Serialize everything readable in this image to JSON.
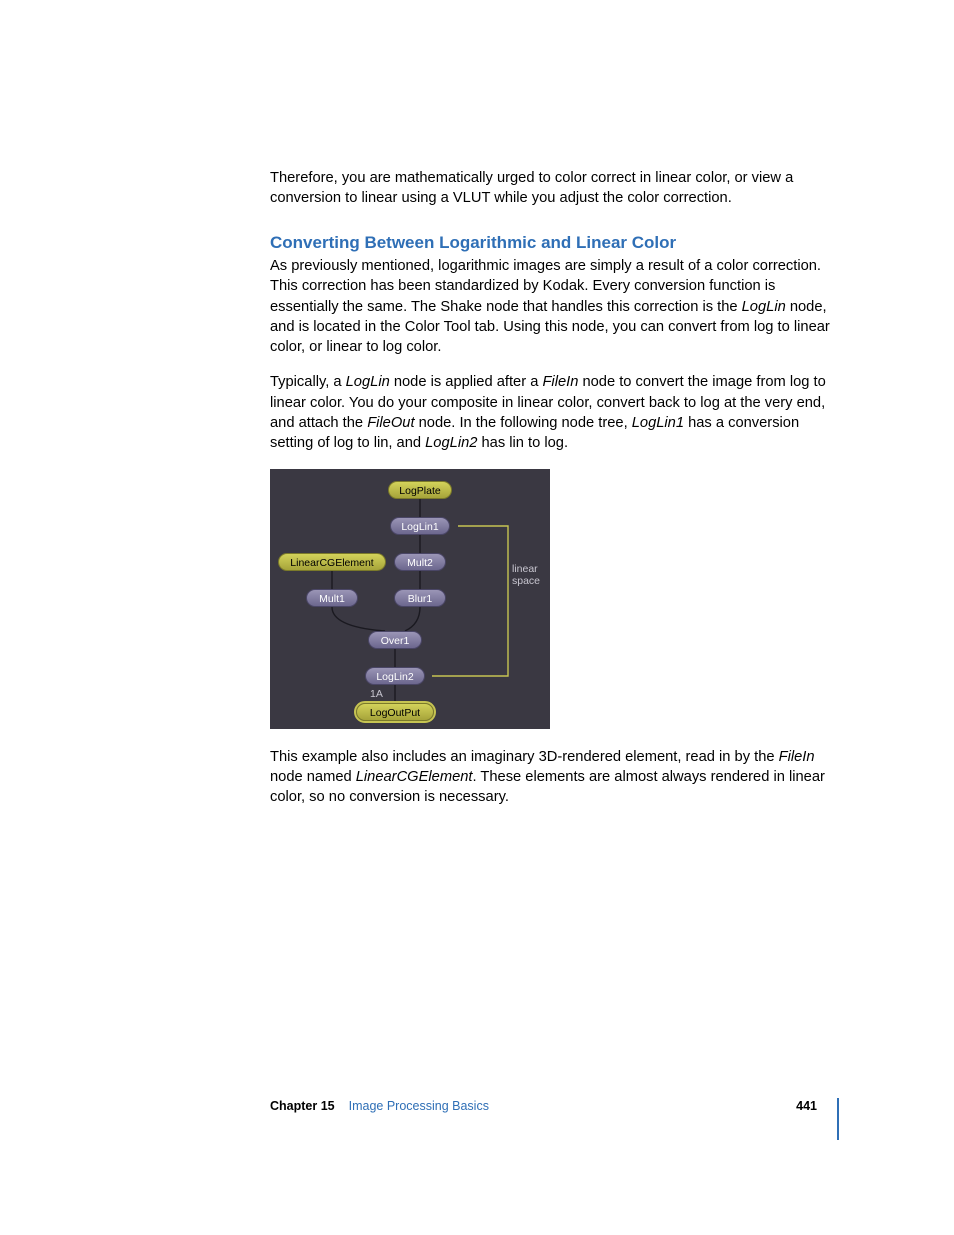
{
  "para1_a": "Therefore, you are mathematically urged to color correct in linear color, or view a conversion to linear using a VLUT while you adjust the color correction.",
  "heading": "Converting Between Logarithmic and Linear Color",
  "para2_a": "As previously mentioned, logarithmic images are simply a result of a color correction. This correction has been standardized by Kodak. Every conversion function is essentially the same. The Shake node that handles this correction is the ",
  "para2_i1": "LogLin",
  "para2_b": " node, and is located in the Color Tool tab. Using this node, you can convert from log to linear color, or linear to log color.",
  "para3_a": "Typically, a ",
  "para3_i1": "LogLin",
  "para3_b": " node is applied after a ",
  "para3_i2": "FileIn",
  "para3_c": " node to convert the image from log to linear color. You do your composite in linear color, convert back to log at the very end, and attach the ",
  "para3_i3": "FileOut",
  "para3_d": " node. In the following node tree, ",
  "para3_i4": "LogLin1",
  "para3_e": " has a conversion setting of log to lin, and ",
  "para3_i5": "LogLin2",
  "para3_f": " has lin to log.",
  "para4_a": "This example also includes an imaginary 3D-rendered element, read in by the ",
  "para4_i1": "FileIn",
  "para4_b": " node named ",
  "para4_i2": "LinearCGElement",
  "para4_c": ". These elements are almost always rendered in linear color, so no conversion is necessary.",
  "nodes": {
    "logplate": "LogPlate",
    "loglin1": "LogLin1",
    "lincg": "LinearCGElement",
    "mult2": "Mult2",
    "mult1": "Mult1",
    "blur1": "Blur1",
    "over1": "Over1",
    "loglin2": "LogLin2",
    "port": "1A",
    "logout": "LogOutPut"
  },
  "ann_linear": "linear",
  "ann_space": "space",
  "footer": {
    "chapter": "Chapter 15",
    "title": "Image Processing Basics",
    "page": "441"
  }
}
